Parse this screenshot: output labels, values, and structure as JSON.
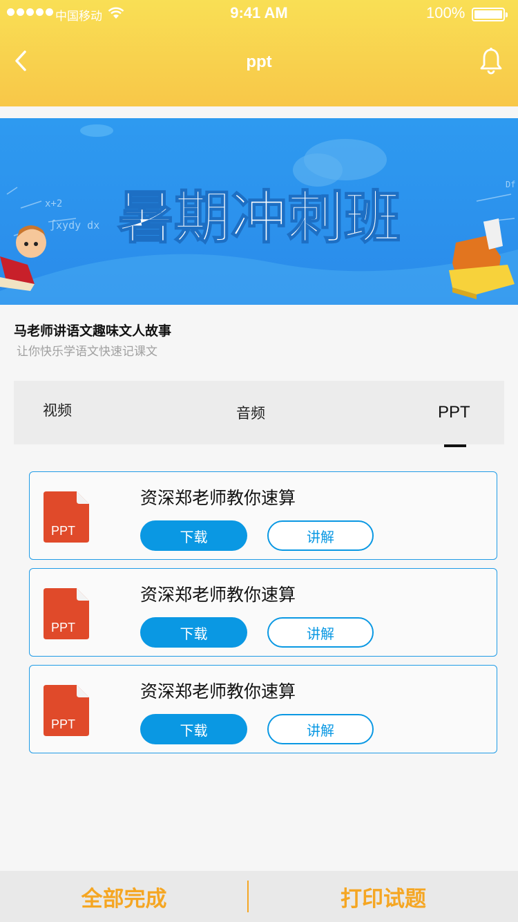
{
  "status_bar": {
    "carrier": "中国移动",
    "time": "9:41 AM",
    "battery": "100%"
  },
  "nav": {
    "title": "ppt"
  },
  "banner": {
    "headline": "暑期冲刺班"
  },
  "course": {
    "title": "马老师讲语文趣味文人故事",
    "subtitle": "让你快乐学语文快速记课文"
  },
  "tabs": [
    {
      "label": "视频"
    },
    {
      "label": "音频"
    },
    {
      "label": "PPT",
      "active": true
    }
  ],
  "items": [
    {
      "icon_label": "PPT",
      "title": "资深郑老师教你速算",
      "download_label": "下载",
      "explain_label": "讲解"
    },
    {
      "icon_label": "PPT",
      "title": "资深郑老师教你速算",
      "download_label": "下载",
      "explain_label": "讲解"
    },
    {
      "icon_label": "PPT",
      "title": "资深郑老师教你速算",
      "download_label": "下载",
      "explain_label": "讲解"
    }
  ],
  "bottom": {
    "all_done": "全部完成",
    "print": "打印试题"
  },
  "colors": {
    "header_yellow": "#f8d14f",
    "primary_blue": "#0a98e3",
    "accent_orange": "#f5a623",
    "ppt_red": "#e04a2a"
  }
}
